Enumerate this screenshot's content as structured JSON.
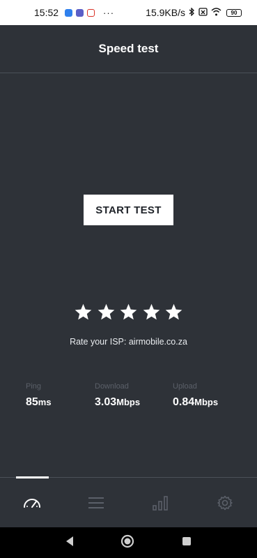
{
  "status_bar": {
    "time": "15:52",
    "notification_icons": [
      "message-icon",
      "teams-icon",
      "gmail-icon"
    ],
    "overflow": "···",
    "network_speed": "15.9KB/s",
    "battery": "90"
  },
  "header": {
    "title": "Speed test"
  },
  "main": {
    "start_button_label": "START TEST",
    "rating": {
      "stars": 5,
      "label": "Rate your ISP: airmobile.co.za"
    }
  },
  "metrics": {
    "ping": {
      "label": "Ping",
      "value": "85",
      "unit": "ms"
    },
    "download": {
      "label": "Download",
      "value": "3.03",
      "unit": "Mbps"
    },
    "upload": {
      "label": "Upload",
      "value": "0.84",
      "unit": "Mbps"
    }
  },
  "tabs": [
    {
      "icon": "speedometer-icon",
      "active": true
    },
    {
      "icon": "list-icon",
      "active": false
    },
    {
      "icon": "signal-bars-icon",
      "active": false
    },
    {
      "icon": "gear-icon",
      "active": false
    }
  ],
  "colors": {
    "background": "#2e3238",
    "divider": "#4b5058",
    "label_muted": "#5b6069",
    "inactive_icon": "#5b6069",
    "button_bg": "#ffffff",
    "button_text": "#1f2329"
  }
}
